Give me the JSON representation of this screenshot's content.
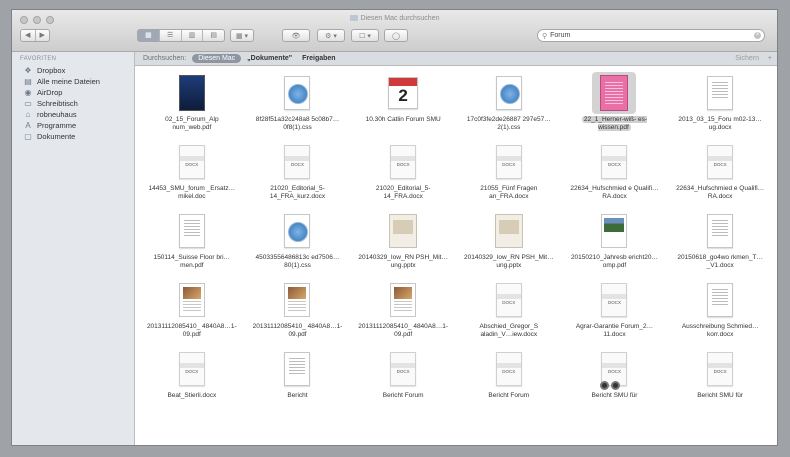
{
  "window": {
    "title": "Diesen Mac durchsuchen"
  },
  "toolbar": {
    "back_label": "◀",
    "forward_label": "▶",
    "view_icon": "▦",
    "view_list": "☰",
    "view_columns": "▥",
    "view_flow": "▤",
    "arrange_label": "▦ ▾",
    "quicklook_label": "👁",
    "action_label": "⚙ ▾",
    "share_label": "☐ ▾",
    "tags_label": "◯"
  },
  "search": {
    "value": "Forum",
    "icon": "magnifier-icon"
  },
  "scopebar": {
    "label": "Durchsuchen:",
    "selected": "Diesen Mac",
    "option_documents": "„Dokumente\"",
    "option_shared": "Freigaben",
    "save_label": "Sichern",
    "add_label": "+"
  },
  "sidebar": {
    "heading": "FAVORITEN",
    "items": [
      {
        "label": "Dropbox",
        "icon": "dropbox-icon",
        "glyph": "❖"
      },
      {
        "label": "Alle meine Dateien",
        "icon": "all-files-icon",
        "glyph": "▤"
      },
      {
        "label": "AirDrop",
        "icon": "airdrop-icon",
        "glyph": "◉"
      },
      {
        "label": "Schreibtisch",
        "icon": "desktop-icon",
        "glyph": "▭"
      },
      {
        "label": "robneuhaus",
        "icon": "home-icon",
        "glyph": "⌂"
      },
      {
        "label": "Programme",
        "icon": "applications-icon",
        "glyph": "A"
      },
      {
        "label": "Dokumente",
        "icon": "documents-icon",
        "glyph": "▢"
      }
    ]
  },
  "files": [
    {
      "name": "02_15_Forum_Alp num_web.pdf",
      "kind": "pdf-dark"
    },
    {
      "name": "8f28f51a32c248a8 5c08b7…0f8(1).css",
      "kind": "css"
    },
    {
      "name": "10.30h Catlin Forum SMU",
      "kind": "calendar",
      "day": "2"
    },
    {
      "name": "17c0f3fe2de26887 297e57…2(1).css",
      "kind": "css"
    },
    {
      "name": "22_1_Herner-wiß- es-wissen.pdf",
      "kind": "pdf-pink",
      "selected": true
    },
    {
      "name": "2013_03_15_Foru m02-13…ug.docx",
      "kind": "doc"
    },
    {
      "name": "14453_SMU_forum _Ersatz…mikel.doc",
      "kind": "docx",
      "tag": "DOCX"
    },
    {
      "name": "21020_Editorial_5- 14_FRA_kurz.docx",
      "kind": "docx",
      "tag": "DOCX"
    },
    {
      "name": "21020_Editorial_5- 14_FRA.docx",
      "kind": "docx",
      "tag": "DOCX"
    },
    {
      "name": "21055_Fünf Fragen an_FRA.docx",
      "kind": "docx",
      "tag": "DOCX"
    },
    {
      "name": "22634_Hufschmied e Qualifi…RA.docx",
      "kind": "docx",
      "tag": "DOCX"
    },
    {
      "name": "22634_Hufschmied e Qualifi…RA.docx",
      "kind": "docx",
      "tag": "DOCX"
    },
    {
      "name": "150114_Suisse Floor bri…men.pdf",
      "kind": "doc"
    },
    {
      "name": "45033556486813c ed7506…80(1).css",
      "kind": "css"
    },
    {
      "name": "20140329_Iow_RN PSH_Mit…ung.pptx",
      "kind": "pptx"
    },
    {
      "name": "20140329_Iow_RN PSH_Mit…ung.pptx",
      "kind": "pptx"
    },
    {
      "name": "20150210_Jahresb ericht20…omp.pdf",
      "kind": "pdf-photo"
    },
    {
      "name": "20150618_go4wo rkmen_T…_V1.docx",
      "kind": "doc"
    },
    {
      "name": "20131112085410_ 4840A8…1-09.pdf",
      "kind": "pdf-brown"
    },
    {
      "name": "20131112085410_ 4840A8…1-09.pdf",
      "kind": "pdf-brown"
    },
    {
      "name": "20131112085410_ 4840A8…1-09.pdf",
      "kind": "pdf-brown"
    },
    {
      "name": "Abschied_Gregor_S aladin_V…iew.docx",
      "kind": "docx",
      "tag": "DOCX"
    },
    {
      "name": "Agrar-Garantie Forum_2…11.docx",
      "kind": "docx",
      "tag": "DOCX"
    },
    {
      "name": "Ausschreibung Schmied…korr.docx",
      "kind": "doc"
    },
    {
      "name": "Beat_Stierli.docx",
      "kind": "docx",
      "tag": "DOCX"
    },
    {
      "name": "Bericht",
      "kind": "doc"
    },
    {
      "name": "Bericht Forum",
      "kind": "docx",
      "tag": "DOCX"
    },
    {
      "name": "Bericht Forum",
      "kind": "docx",
      "tag": "DOCX"
    },
    {
      "name": "Bericht SMU für",
      "kind": "docx",
      "tag": "DOCX",
      "busy": true
    },
    {
      "name": "Bericht SMU für",
      "kind": "docx",
      "tag": "DOCX"
    }
  ]
}
